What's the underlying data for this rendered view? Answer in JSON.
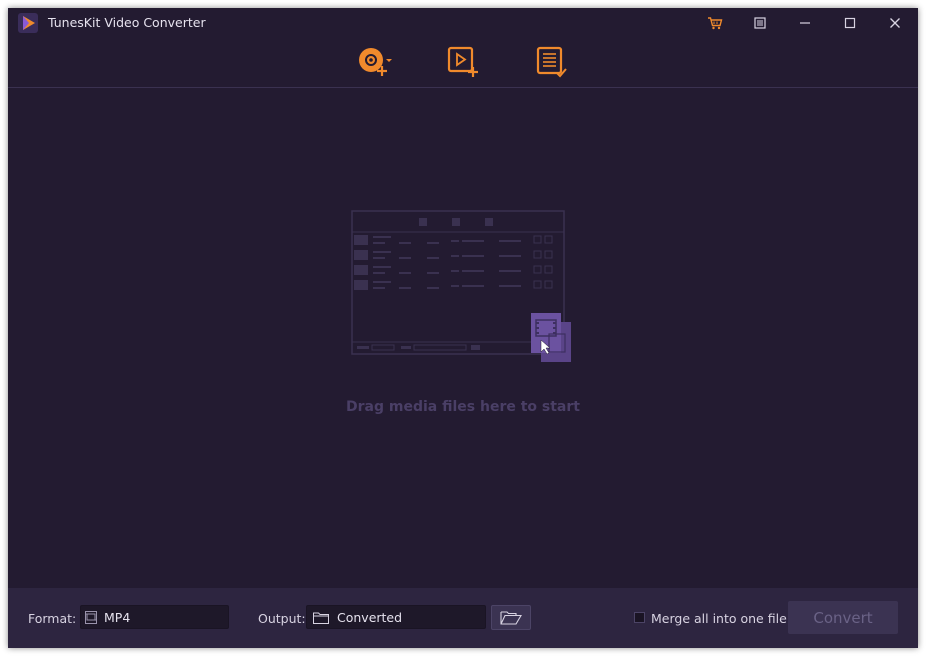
{
  "window": {
    "title": "TunesKit Video Converter"
  },
  "titlebar_icons": [
    "cart-icon",
    "menu-icon",
    "minimize-icon",
    "maximize-icon",
    "close-icon"
  ],
  "toolbar_icons": [
    "add-dvd-icon",
    "add-video-icon",
    "converted-list-icon"
  ],
  "dropzone": {
    "hint": "Drag media files here to start"
  },
  "bottom": {
    "format_label": "Format:",
    "format_value": "MP4",
    "output_label": "Output:",
    "output_value": "Converted",
    "merge_label": "Merge all into one file",
    "merge_checked": false,
    "convert_label": "Convert"
  },
  "colors": {
    "accent": "#f08a2c",
    "background": "#231b31",
    "bottom_bar": "#2d2540",
    "hint_text": "#4a3f66"
  }
}
